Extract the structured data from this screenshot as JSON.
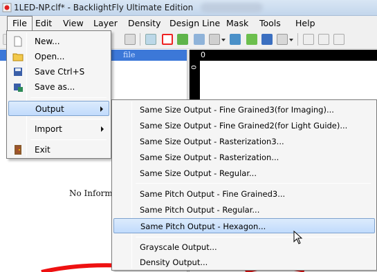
{
  "window": {
    "title": "1LED-NP.clf* - BacklightFly Ultimate Edition",
    "app_icon": "red-led-icon"
  },
  "menubar": {
    "items": [
      {
        "label": "File"
      },
      {
        "label": "Edit"
      },
      {
        "label": "View"
      },
      {
        "label": "Layer"
      },
      {
        "label": "Density"
      },
      {
        "label": "Design Line"
      },
      {
        "label": "Mask"
      },
      {
        "label": "Tools"
      },
      {
        "label": "Help"
      }
    ],
    "active": "File"
  },
  "workspace": {
    "pane_header_text": "file",
    "no_info_text": "No Informat",
    "ruler_origin": "0"
  },
  "file_menu": {
    "items": [
      {
        "label": "New...",
        "icon": "new-document-icon"
      },
      {
        "label": "Open...",
        "icon": "open-folder-icon"
      },
      {
        "label": "Save  Ctrl+S",
        "icon": "save-disk-icon"
      },
      {
        "label": "Save as...",
        "icon": "save-as-icon"
      },
      {
        "label": "Output",
        "has_submenu": true,
        "highlighted": true
      },
      {
        "label": "Import",
        "has_submenu": true
      },
      {
        "label": "Exit",
        "icon": "exit-door-icon"
      }
    ]
  },
  "output_submenu": {
    "items": [
      {
        "label": "Same Size Output - Fine Grained3(for Imaging)..."
      },
      {
        "label": "Same Size Output - Fine Grained2(for Light Guide)..."
      },
      {
        "label": "Same Size Output - Rasterization3..."
      },
      {
        "label": "Same Size Output - Rasterization..."
      },
      {
        "label": "Same Size Output - Regular..."
      },
      {
        "label": "Same Pitch Output - Fine Grained3..."
      },
      {
        "label": "Same Pitch Output - Regular..."
      },
      {
        "label": "Same Pitch Output - Hexagon...",
        "highlighted": true
      },
      {
        "label": "Grayscale Output..."
      },
      {
        "label": "Density Output..."
      }
    ]
  },
  "colors": {
    "menu_highlight": "#c1dbfc",
    "pane_header": "#3c78d8",
    "annotation_red": "#ee1111"
  }
}
